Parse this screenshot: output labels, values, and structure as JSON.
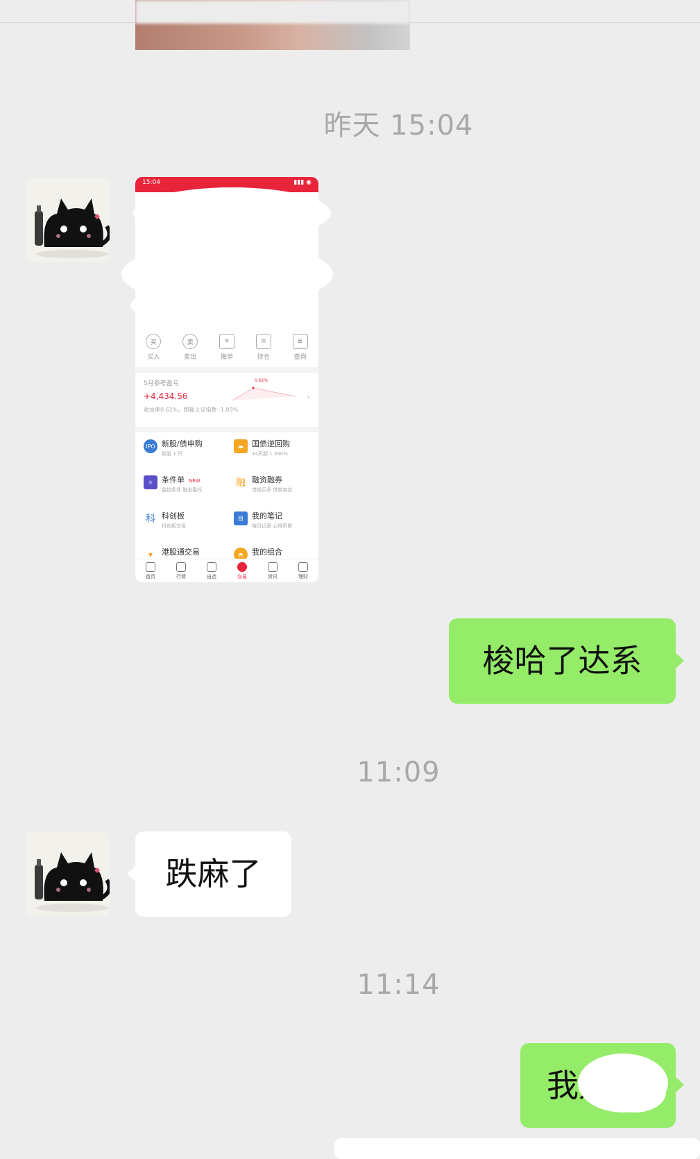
{
  "timestamps": [
    "昨天 15:04",
    "11:09",
    "11:14"
  ],
  "messages": {
    "outgoing_1": "梭哈了达系",
    "incoming_1": "跌麻了",
    "outgoing_2": "我是"
  },
  "screenshot": {
    "status_time": "15:04",
    "quick_actions": [
      {
        "icon": "买",
        "label": "买入"
      },
      {
        "icon": "卖",
        "label": "卖出"
      },
      {
        "icon": "✕",
        "label": "撤单"
      },
      {
        "icon": "≡",
        "label": "持仓"
      },
      {
        "icon": "≣",
        "label": "查询"
      }
    ],
    "pnl": {
      "title": "5月参考盈亏",
      "value": "+4,434.56",
      "sub": "收益率0.62%，跑输上证指数 -1.03%",
      "chart_label": "0.62%"
    },
    "services": [
      {
        "title": "新股/债申购",
        "sub": "新股 1 只",
        "icon": "IPO",
        "color": "#3a7bd5"
      },
      {
        "title": "国债逆回购",
        "sub": "14天期 1.390%",
        "icon": "▬",
        "color": "#f5a623"
      },
      {
        "title": "条件单",
        "sub": "监控条件 触发委托",
        "icon": "☼",
        "color": "#5b4ec9",
        "badge": "NEW"
      },
      {
        "title": "融资融券",
        "sub": "借钱买多 借券卖空",
        "icon": "融",
        "color": "#f5a623"
      },
      {
        "title": "科创板",
        "sub": "科创板交易",
        "icon": "科",
        "color": "#3a7bd5"
      },
      {
        "title": "我的笔记",
        "sub": "每日记录 心得积累",
        "icon": "目",
        "color": "#3a7bd5"
      },
      {
        "title": "港股通交易",
        "sub": "",
        "icon": "▼",
        "color": "#f5a623"
      },
      {
        "title": "我的组合",
        "sub": "",
        "icon": "◓",
        "color": "#f5a623"
      }
    ],
    "tabs": [
      "首页",
      "行情",
      "自选",
      "交易",
      "资讯",
      "理财"
    ]
  }
}
